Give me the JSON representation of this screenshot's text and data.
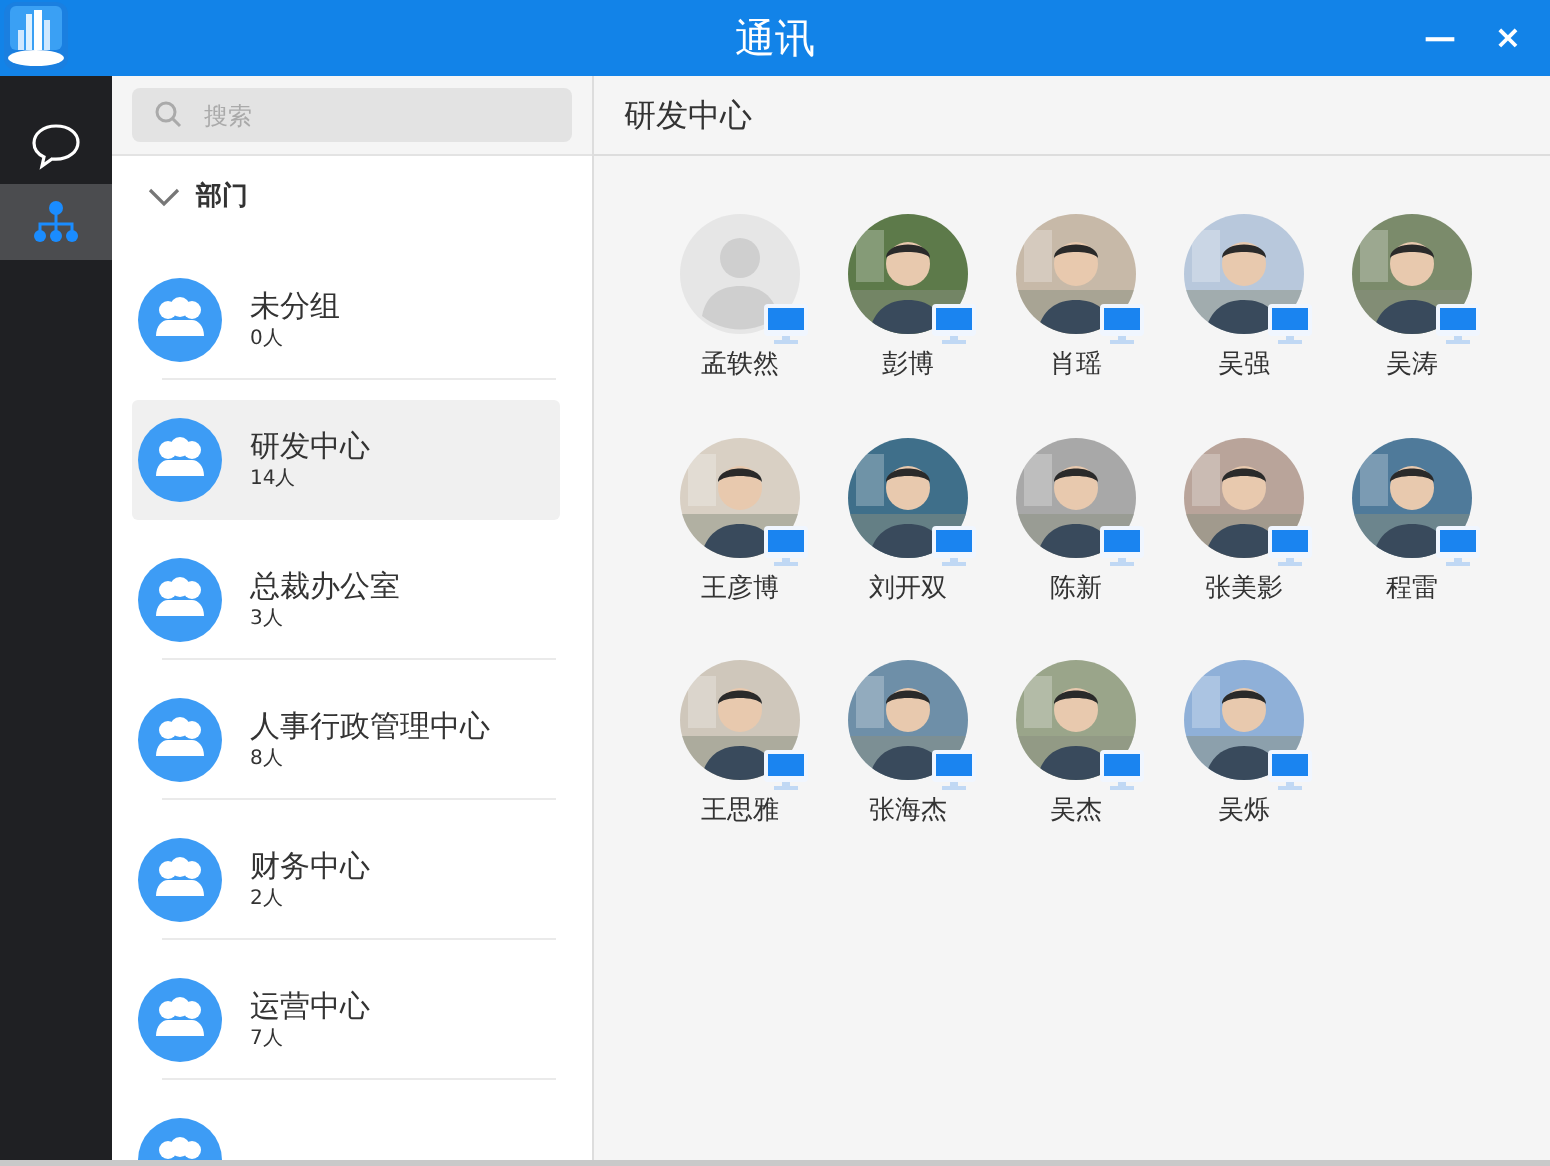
{
  "window": {
    "title": "通讯",
    "controls": [
      "—",
      "×"
    ]
  },
  "rail": [
    {
      "kind": "chat",
      "selected": false
    },
    {
      "kind": "org",
      "selected": true
    }
  ],
  "search": {
    "placeholder": "搜索"
  },
  "section": {
    "label": "部门",
    "expanded": true
  },
  "departments": [
    {
      "name": "未分组",
      "count": "0人",
      "selected": false
    },
    {
      "name": "研发中心",
      "count": "14人",
      "selected": true
    },
    {
      "name": "总裁办公室",
      "count": "3人",
      "selected": false
    },
    {
      "name": "人事行政管理中心",
      "count": "8人",
      "selected": false
    },
    {
      "name": "财务中心",
      "count": "2人",
      "selected": false
    },
    {
      "name": "运营中心",
      "count": "7人",
      "selected": false
    },
    {
      "selected": false
    }
  ],
  "panel": {
    "title": "研发中心"
  },
  "members": [
    {
      "name": "孟轶然",
      "kind": "default",
      "online": true
    },
    {
      "name": "彭博",
      "online": true
    },
    {
      "name": "肖瑶",
      "online": true
    },
    {
      "name": "吴强",
      "online": true
    },
    {
      "name": "吴涛",
      "online": true
    },
    {
      "name": "王彦博",
      "online": true
    },
    {
      "name": "刘开双",
      "online": true
    },
    {
      "name": "陈新",
      "online": true
    },
    {
      "name": "张美影",
      "online": true
    },
    {
      "name": "程雷",
      "online": true
    },
    {
      "name": "王思雅",
      "online": true
    },
    {
      "name": "张海杰",
      "online": true
    },
    {
      "name": "吴杰",
      "online": true
    },
    {
      "name": "吴烁",
      "online": true
    }
  ]
}
